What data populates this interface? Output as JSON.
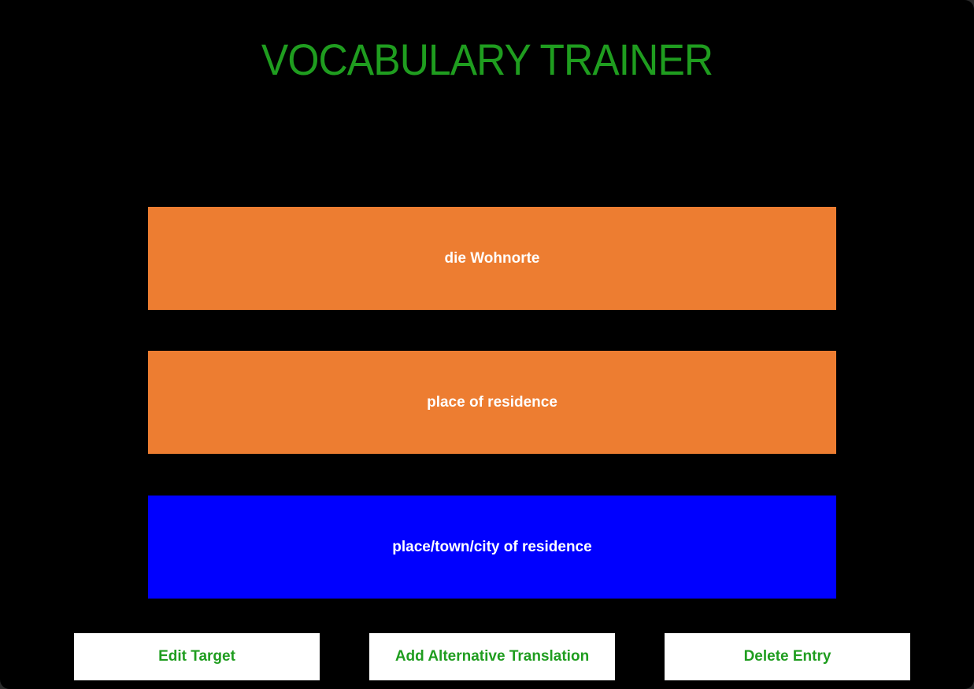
{
  "app": {
    "title": "VOCABULARY TRAINER"
  },
  "cards": {
    "source_word": "die Wohnorte",
    "translation": "place of residence",
    "alternative": "place/town/city of residence"
  },
  "actions": {
    "edit_target": "Edit Target",
    "add_alternative": "Add Alternative Translation",
    "delete_entry": "Delete Entry"
  },
  "colors": {
    "background": "#000000",
    "title": "#1f9d1f",
    "card_primary": "#ed7d31",
    "card_selected": "#0000ff",
    "button_bg": "#ffffff",
    "button_text": "#1f9d1f"
  }
}
